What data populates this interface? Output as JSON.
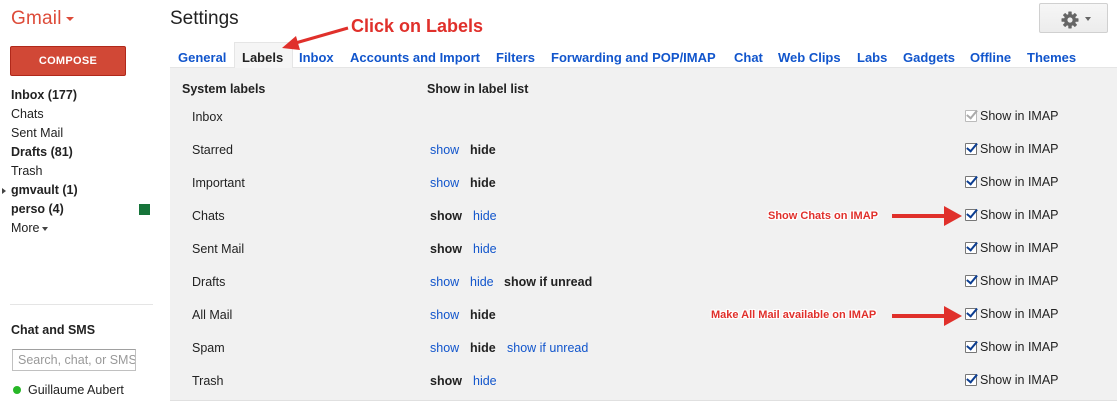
{
  "app": {
    "logo": "Gmail",
    "page_title": "Settings"
  },
  "sidebar": {
    "compose_label": "COMPOSE",
    "items": [
      {
        "label": "Inbox (177)",
        "bold": true
      },
      {
        "label": "Chats",
        "bold": false
      },
      {
        "label": "Sent Mail",
        "bold": false
      },
      {
        "label": "Drafts (81)",
        "bold": true
      },
      {
        "label": "Trash",
        "bold": false
      },
      {
        "label": "gmvault (1)",
        "bold": true
      },
      {
        "label": "perso (4)",
        "bold": true,
        "color": "#16743a"
      },
      {
        "label": "More",
        "bold": false
      }
    ],
    "chat_title": "Chat and SMS",
    "chat_search_placeholder": "Search, chat, or SMS",
    "contact_name": "Guillaume Aubert",
    "contact_status_color": "#27b727"
  },
  "tabs": [
    "General",
    "Labels",
    "Inbox",
    "Accounts and Import",
    "Filters",
    "Forwarding and POP/IMAP",
    "Chat",
    "Web Clips",
    "Labs",
    "Gadgets",
    "Offline",
    "Themes"
  ],
  "active_tab": "Labels",
  "labels_table": {
    "header_system": "System labels",
    "header_show": "Show in label list",
    "rows": [
      {
        "name": "Inbox",
        "imap": "Show in IMAP",
        "imap_checked": true,
        "imap_disabled": true
      },
      {
        "name": "Starred",
        "show": "show",
        "hide": "hide",
        "selected": "hide",
        "imap": "Show in IMAP",
        "imap_checked": true
      },
      {
        "name": "Important",
        "show": "show",
        "hide": "hide",
        "selected": "hide",
        "imap": "Show in IMAP",
        "imap_checked": true
      },
      {
        "name": "Chats",
        "show": "show",
        "hide": "hide",
        "selected": "show",
        "imap": "Show in IMAP",
        "imap_checked": true
      },
      {
        "name": "Sent Mail",
        "show": "show",
        "hide": "hide",
        "selected": "show",
        "imap": "Show in IMAP",
        "imap_checked": true
      },
      {
        "name": "Drafts",
        "show": "show",
        "hide": "hide",
        "unread": "show if unread",
        "selected": "unread",
        "imap": "Show in IMAP",
        "imap_checked": true
      },
      {
        "name": "All Mail",
        "show": "show",
        "hide": "hide",
        "selected": "hide",
        "imap": "Show in IMAP",
        "imap_checked": true
      },
      {
        "name": "Spam",
        "show": "show",
        "hide": "hide",
        "unread": "show if unread",
        "selected": "hide",
        "imap": "Show in IMAP",
        "imap_checked": true
      },
      {
        "name": "Trash",
        "show": "show",
        "hide": "hide",
        "selected": "show",
        "imap": "Show in IMAP",
        "imap_checked": true
      }
    ]
  },
  "annotations": {
    "click_labels": "Click on Labels",
    "show_chats": "Show Chats on IMAP",
    "all_mail": "Make All Mail available on IMAP",
    "color": "#e0302b"
  },
  "colors": {
    "brand": "#dd4b39",
    "compose": "#d14836",
    "link": "#1155cc",
    "panel": "#f1f1f1"
  }
}
